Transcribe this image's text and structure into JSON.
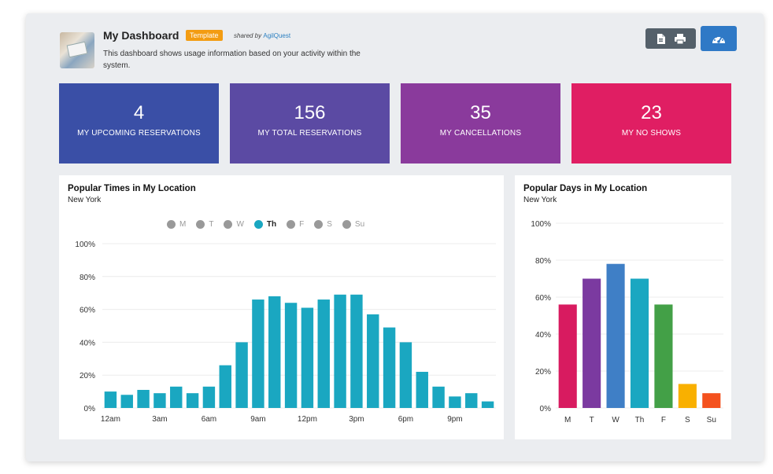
{
  "header": {
    "title": "My Dashboard",
    "tag": "Template",
    "shared_by_prefix": "shared by",
    "shared_by_name": "AgilQuest",
    "description": "This dashboard shows usage information based on your activity within the system."
  },
  "toolbar": {
    "export_icon": "file-icon",
    "print_icon": "print-icon",
    "dashboard_icon": "speedometer-icon"
  },
  "tiles": [
    {
      "value": "4",
      "label": "MY UPCOMING RESERVATIONS",
      "color": "#3a4fa6"
    },
    {
      "value": "156",
      "label": "MY TOTAL RESERVATIONS",
      "color": "#5b4aa3"
    },
    {
      "value": "35",
      "label": "MY CANCELLATIONS",
      "color": "#8a3a9c"
    },
    {
      "value": "23",
      "label": "MY NO SHOWS",
      "color": "#e01e63"
    }
  ],
  "popular_times": {
    "title": "Popular Times in My Location",
    "subtitle": "New York",
    "legend": [
      "M",
      "T",
      "W",
      "Th",
      "F",
      "S",
      "Su"
    ],
    "selected_day": "Th"
  },
  "popular_days": {
    "title": "Popular Days in My Location",
    "subtitle": "New York"
  },
  "chart_data": [
    {
      "type": "bar",
      "title": "Popular Times in My Location",
      "subtitle": "New York",
      "categories": [
        "12am",
        "1am",
        "2am",
        "3am",
        "4am",
        "5am",
        "6am",
        "7am",
        "8am",
        "9am",
        "10am",
        "11am",
        "12pm",
        "1pm",
        "2pm",
        "3pm",
        "4pm",
        "5pm",
        "6pm",
        "7pm",
        "8pm",
        "9pm",
        "10pm",
        "11pm"
      ],
      "tick_labels": [
        "12am",
        "3am",
        "6am",
        "9am",
        "12pm",
        "3pm",
        "6pm",
        "9pm"
      ],
      "values": [
        10,
        8,
        11,
        9,
        13,
        9,
        13,
        26,
        40,
        66,
        68,
        64,
        61,
        66,
        69,
        69,
        57,
        49,
        40,
        22,
        13,
        7,
        9,
        4
      ],
      "ylim": [
        0,
        100
      ],
      "yticks": [
        "0%",
        "20%",
        "40%",
        "60%",
        "80%",
        "100%"
      ],
      "color": "#1aa7c1",
      "grid": true
    },
    {
      "type": "bar",
      "title": "Popular Days in My Location",
      "subtitle": "New York",
      "categories": [
        "M",
        "T",
        "W",
        "Th",
        "F",
        "S",
        "Su"
      ],
      "values": [
        56,
        70,
        78,
        70,
        56,
        13,
        8
      ],
      "colors": [
        "#d81b60",
        "#7b3aa0",
        "#3f7fc6",
        "#1aa7c1",
        "#43a047",
        "#f9b000",
        "#f4511e"
      ],
      "ylim": [
        0,
        100
      ],
      "yticks": [
        "0%",
        "20%",
        "40%",
        "60%",
        "80%",
        "100%"
      ],
      "grid": true
    }
  ]
}
